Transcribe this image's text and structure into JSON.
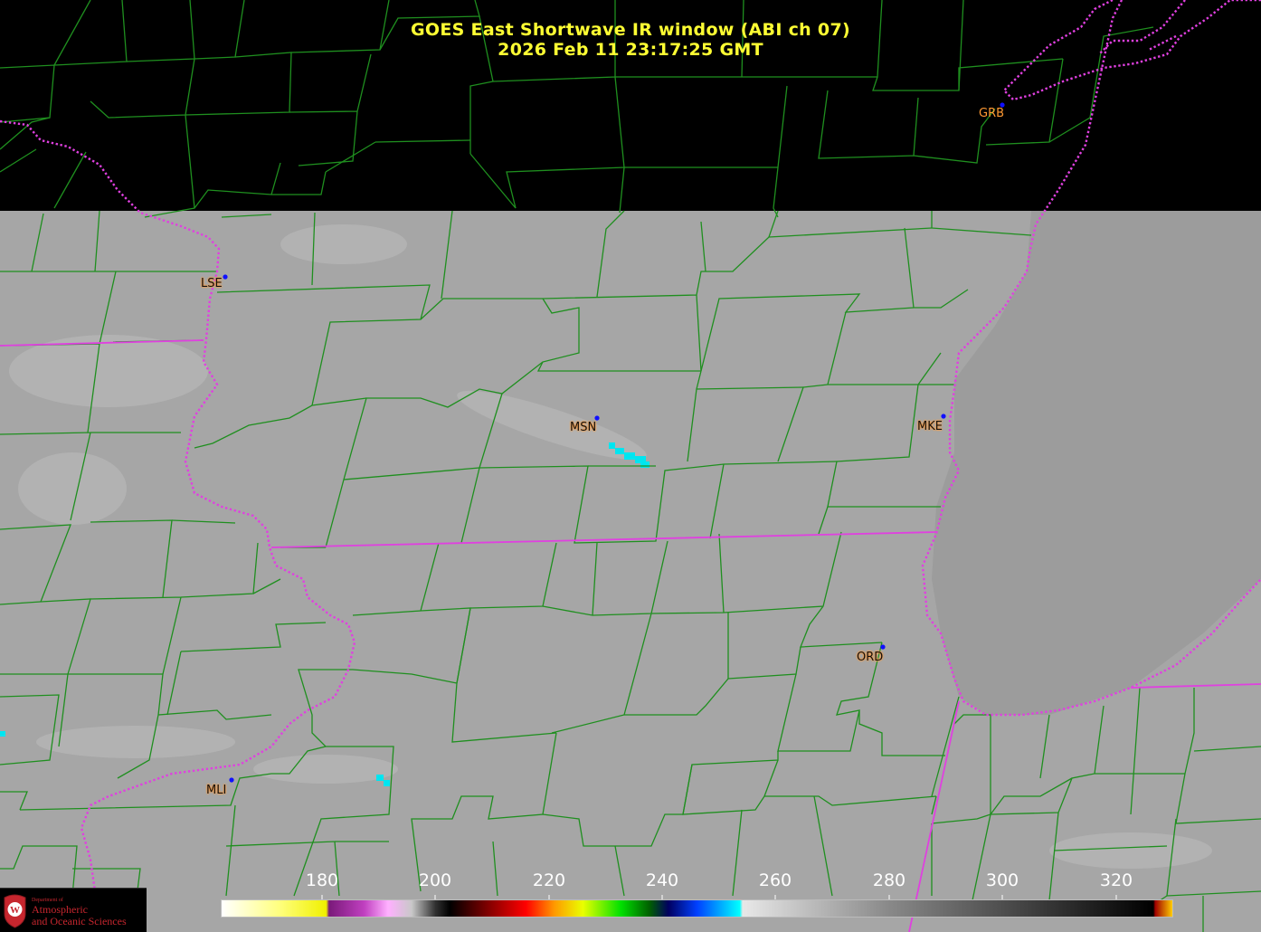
{
  "title": {
    "line1": "GOES East Shortwave IR window (ABI ch 07)",
    "line2": "2026 Feb 11  23:17:25 GMT"
  },
  "colors": {
    "title": "#ffff33",
    "county_lines": "#1f8f1f",
    "state_lines": "#e040e0",
    "station_dot": "#1010ff",
    "station_label": "#ff9933"
  },
  "stations": [
    {
      "id": "GRB",
      "label": "GRB"
    },
    {
      "id": "LSE",
      "label": "LSE"
    },
    {
      "id": "MSN",
      "label": "MSN"
    },
    {
      "id": "MKE",
      "label": "MKE"
    },
    {
      "id": "ORD",
      "label": "ORD"
    },
    {
      "id": "MLI",
      "label": "MLI"
    }
  ],
  "colorbar": {
    "unit_hint": "brightness temperature",
    "min": 162,
    "max": 326,
    "ticks": [
      "180",
      "200",
      "220",
      "240",
      "260",
      "280",
      "300",
      "320"
    ]
  },
  "logo": {
    "dept": "Department of",
    "line1": "Atmospheric",
    "line2": "and Oceanic Sciences"
  }
}
